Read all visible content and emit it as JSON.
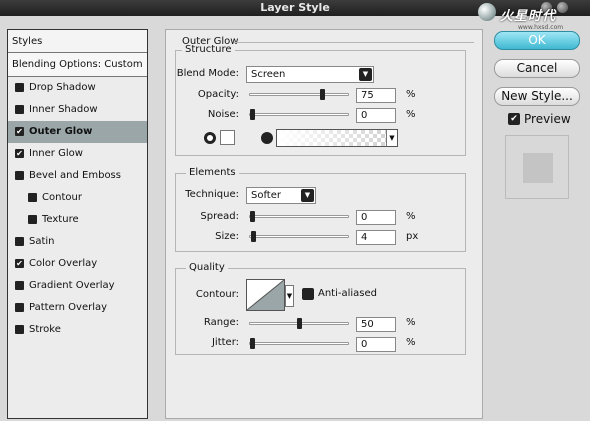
{
  "window": {
    "title": "Layer Style"
  },
  "logo": {
    "text": "火星时代",
    "url": "www.hxsd.com"
  },
  "styles_panel": {
    "header": "Styles",
    "blending": "Blending Options: Custom",
    "items": [
      {
        "label": "Drop Shadow",
        "checked": false,
        "sub": false,
        "selected": false
      },
      {
        "label": "Inner Shadow",
        "checked": false,
        "sub": false,
        "selected": false
      },
      {
        "label": "Outer Glow",
        "checked": true,
        "sub": false,
        "selected": true
      },
      {
        "label": "Inner Glow",
        "checked": true,
        "sub": false,
        "selected": false
      },
      {
        "label": "Bevel and Emboss",
        "checked": false,
        "sub": false,
        "selected": false
      },
      {
        "label": "Contour",
        "checked": false,
        "sub": true,
        "selected": false
      },
      {
        "label": "Texture",
        "checked": false,
        "sub": true,
        "selected": false
      },
      {
        "label": "Satin",
        "checked": false,
        "sub": false,
        "selected": false
      },
      {
        "label": "Color Overlay",
        "checked": true,
        "sub": false,
        "selected": false
      },
      {
        "label": "Gradient Overlay",
        "checked": false,
        "sub": false,
        "selected": false
      },
      {
        "label": "Pattern Overlay",
        "checked": false,
        "sub": false,
        "selected": false
      },
      {
        "label": "Stroke",
        "checked": false,
        "sub": false,
        "selected": false
      }
    ]
  },
  "outer_glow": {
    "title": "Outer Glow",
    "structure": {
      "title": "Structure",
      "blend_mode_label": "Blend Mode:",
      "blend_mode": "Screen",
      "opacity_label": "Opacity:",
      "opacity": "75",
      "opacity_unit": "%",
      "opacity_level": 0.75,
      "noise_label": "Noise:",
      "noise": "0",
      "noise_unit": "%",
      "noise_level": 0
    },
    "elements": {
      "title": "Elements",
      "technique_label": "Technique:",
      "technique": "Softer",
      "spread_label": "Spread:",
      "spread": "0",
      "spread_unit": "%",
      "spread_level": 0,
      "size_label": "Size:",
      "size": "4",
      "size_unit": "px",
      "size_level": 0.016
    },
    "quality": {
      "title": "Quality",
      "contour_label": "Contour:",
      "anti_aliased_label": "Anti-aliased",
      "range_label": "Range:",
      "range": "50",
      "range_unit": "%",
      "range_level": 0.5,
      "jitter_label": "Jitter:",
      "jitter": "0",
      "jitter_unit": "%",
      "jitter_level": 0
    }
  },
  "buttons": {
    "ok": "OK",
    "cancel": "Cancel",
    "new_style": "New Style..."
  },
  "preview": {
    "label": "Preview",
    "checked": true
  },
  "colors": {
    "accent": "#3fb9d2",
    "selected_row": "#9ba6a8",
    "title_bar": "#2a2a2a"
  }
}
